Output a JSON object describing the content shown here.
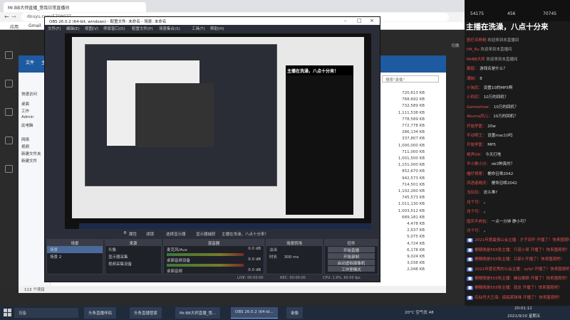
{
  "browser": {
    "tab_title": "Mr.BB大师直播_悠哉日常直播间",
    "address": "douyu.com/5708037",
    "bookmarks": [
      "应用",
      "Gmail"
    ],
    "right_rail_label": "切换"
  },
  "explorer": {
    "ribbon": [
      "文件",
      "主页"
    ],
    "nav": [
      "快速访问",
      "桌面",
      "工作",
      "Admin",
      "此电脑",
      "网络",
      "视频",
      "新建文件夹",
      "新建文件"
    ],
    "search_placeholder": "搜索\"录像\"",
    "sizes": [
      "720,613 KB",
      "768,692 KB",
      "732,589 KB",
      "1,111,538 KB",
      "778,589 KB",
      "772,778 KB",
      "286,134 KB",
      "337,807 KB",
      "1,000,000 KB",
      "711,000 KB",
      "1,001,500 KB",
      "1,151,000 KB",
      "852,670 KB",
      "942,573 KB",
      "714,501 KB",
      "1,102,260 KB",
      "745,573 KB",
      "1,011,130 KB",
      "1,003,512 KB",
      "689,181 KB",
      "4,478 KB",
      "2,637 KB",
      "5,075 KB",
      "4,724 KB",
      "6,178 KB",
      "9,024 KB",
      "3,038 KB",
      "2,048 KB"
    ],
    "status": "113 个项目"
  },
  "obs": {
    "title": "OBS 26.0.2 (64-bit, windows) - 配置文件: 未命名 - 场景: 未命名",
    "menu": [
      "文件(F)",
      "编辑(E)",
      "视图(V)",
      "停靠窗口(D)",
      "配置文件(P)",
      "场景集合(S)",
      "工具(T)",
      "帮助(H)"
    ],
    "preview_banner": "主播在洗澡，八点十分来！",
    "toolbar": [
      "属性",
      "滤镜",
      "选择显示器",
      "显示器捕获",
      "主播在洗澡，八点十分来！"
    ],
    "docks": {
      "scenes": {
        "title": "场景",
        "items": [
          "场景",
          "场景 2"
        ]
      },
      "sources": {
        "title": "来源",
        "items": [
          "头像",
          "显示器采集",
          "视频采集设备"
        ]
      },
      "mixer": {
        "title": "混音器",
        "ch1": "麦克风/Aux",
        "ch1_db": "0.0 dB",
        "ch2": "桌面音频设备",
        "ch2_db": "0.0 dB",
        "ch3": "桌面音频",
        "ch3_db": "0.0 dB"
      },
      "transitions": {
        "title": "场景转场",
        "type": "淡出",
        "duration_label": "时长",
        "duration": "300 ms"
      },
      "controls": {
        "title": "控件",
        "buttons": [
          "开始直播",
          "开始录制",
          "启动虚拟摄像机",
          "工作室模式",
          "设置",
          "退出"
        ]
      }
    },
    "status": [
      "LIVE: 00:00:00",
      "REC: 00:00:00",
      "CPU: 1.9%, 60.00 fps"
    ]
  },
  "chat": {
    "stats": [
      "54175",
      "456",
      "70745"
    ],
    "banner": "主播在洗澡，八点十分来",
    "messages": [
      {
        "user": "医疗兵杨杨",
        "text": "欢迎来到本直播间",
        "type": "welcome"
      },
      {
        "user": "HA_Ru",
        "text": "欢迎来到本直播间",
        "type": "welcome"
      },
      {
        "user": "MrBB大师",
        "text": "欢迎来到本直播间",
        "type": "welcome"
      },
      {
        "user": "蘑菇：",
        "text": "游戏名是什么？",
        "type": "chat"
      },
      {
        "user": "潮纳：",
        "text": "8",
        "type": "chat"
      },
      {
        "user": "小淘忍：",
        "text": "设置10的MP5啊",
        "type": "chat"
      },
      {
        "user": "小四忍：",
        "text": "10万的回机？",
        "type": "chat"
      },
      {
        "user": "Gameshow：",
        "text": "10万的回机？",
        "type": "chat"
      },
      {
        "user": "Akuma风儿：",
        "text": "10万的回机？",
        "type": "chat"
      },
      {
        "user": "开始学医：",
        "text": "20w",
        "type": "chat"
      },
      {
        "user": "不动明王：",
        "text": "设置mac10吗",
        "type": "chat"
      },
      {
        "user": "开始学医：",
        "text": "MP5",
        "type": "chat"
      },
      {
        "user": "绝声OK：",
        "text": "今天打啥",
        "type": "chat"
      },
      {
        "user": "不小数小分：",
        "text": "ob3种真的？",
        "type": "chat"
      },
      {
        "user": "喵仔哥哥：",
        "text": "梗命召唤2042",
        "type": "chat"
      },
      {
        "user": "风语者精灵：",
        "text": "梗命召唤2042",
        "type": "chat"
      },
      {
        "user": "当玩玩：",
        "text": "这么难?",
        "type": "chat"
      },
      {
        "user": "兆个可：",
        "text": "。",
        "type": "chat"
      },
      {
        "user": "兆个可：",
        "text": "。",
        "type": "chat"
      },
      {
        "user": "国庆不肉包：",
        "text": "一点一分钟 静小可？",
        "type": "chat"
      },
      {
        "user": "兆个可：",
        "text": "。",
        "type": "chat"
      },
      {
        "user": "",
        "text": "2021年度最强公会主播 · 才子到开 开播了！快来围观吧！",
        "type": "gift"
      },
      {
        "user": "",
        "text": "梗精贱是555秋主播：只道小哥 开播了！快来围观吧！",
        "type": "gift"
      },
      {
        "user": "",
        "text": "梗精贱是555秋主播：兰部3 开播了！快来围观吧！",
        "type": "gift"
      },
      {
        "user": "",
        "text": "2021年度优秀的公会主播：zyfyf 开播了！快来围观吧！",
        "type": "gift"
      },
      {
        "user": "",
        "text": "梗精贱是555秋主播：峰玩晚聊 开播了！快来围观吧！",
        "type": "gift"
      },
      {
        "user": "",
        "text": "梗精贱是555秋主播：就这 开播了！快来围观吧！",
        "type": "gift"
      },
      {
        "user": "",
        "text": "石仙号大王海：搞搞笑咪咪 开播了！快来围观吧！",
        "type": "gift"
      }
    ]
  },
  "taskbar": {
    "search": "设备",
    "apps": [
      "头条直播伴侣",
      "头条直播管家",
      "Mr.BB大师直播_悠...",
      "OBS 26.0.2 (64-bi...",
      "录像"
    ],
    "weather": "20°C 空气优 48",
    "time": "20:01:12",
    "date": "2021/9/10 星期五"
  }
}
